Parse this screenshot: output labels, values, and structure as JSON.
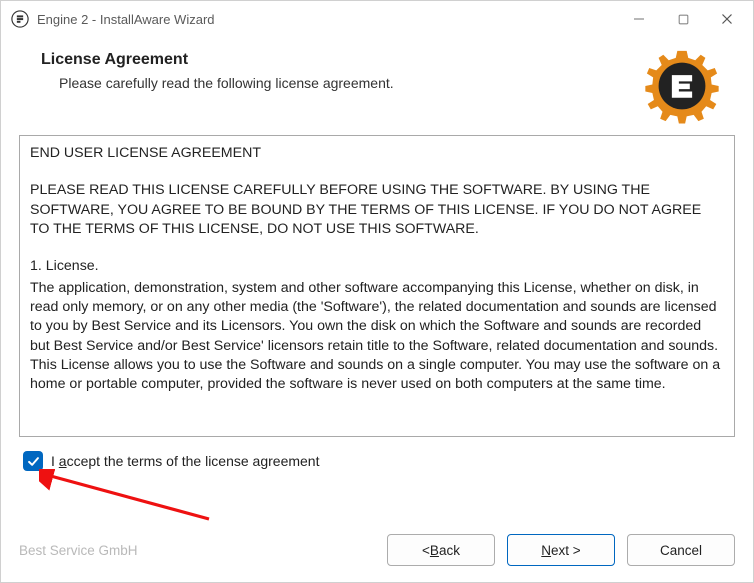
{
  "window": {
    "title": "Engine 2 - InstallAware Wizard"
  },
  "header": {
    "title": "License Agreement",
    "subtitle": "Please carefully read the following license agreement."
  },
  "license": {
    "line1": "END USER LICENSE AGREEMENT",
    "para1": "PLEASE READ THIS LICENSE CAREFULLY BEFORE USING THE SOFTWARE. BY USING THE SOFTWARE, YOU AGREE TO BE BOUND BY THE TERMS OF THIS LICENSE. IF YOU DO NOT AGREE TO THE TERMS OF THIS LICENSE, DO NOT USE THIS SOFTWARE.",
    "sec1_title": "1. License.",
    "sec1_body": "The application, demonstration, system and other software accompanying this License, whether on disk, in read only memory, or on any other media (the 'Software'), the related documentation and sounds are licensed to you by Best Service and its Licensors. You own the disk on which the Software and sounds are recorded but Best Service and/or Best Service' licensors retain title to the Software, related documentation and sounds. This License allows you to use the Software and sounds on a single computer. You may use the software on a home or portable computer, provided the software is never used on both computers at the same time."
  },
  "accept": {
    "prefix": "I",
    "underlineChar": "a",
    "rest": "ccept the terms of the license agreement",
    "checked": true
  },
  "footer": {
    "company": "Best Service GmbH",
    "back": {
      "lt": "< ",
      "u": "B",
      "rest": "ack"
    },
    "next": {
      "u": "N",
      "rest": "ext >"
    },
    "cancel": "Cancel"
  }
}
